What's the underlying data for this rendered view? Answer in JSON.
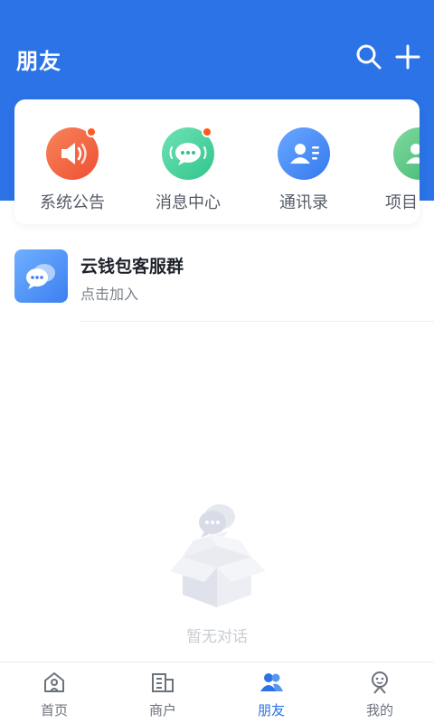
{
  "header": {
    "title": "朋友"
  },
  "quick_entries": [
    {
      "label": "系统公告",
      "icon": "speaker-icon",
      "color": "#f2683f",
      "badge": true
    },
    {
      "label": "消息中心",
      "icon": "message-icon",
      "color": "#3fcc97",
      "badge": true
    },
    {
      "label": "通讯录",
      "icon": "contacts-icon",
      "color": "#3c86f0",
      "badge": false
    },
    {
      "label": "项目",
      "icon": "project-icon",
      "color": "#4bbf7a",
      "badge": false
    }
  ],
  "group": {
    "name": "云钱包客服群",
    "subtitle": "点击加入"
  },
  "empty": {
    "text": "暂无对话"
  },
  "tabbar": {
    "items": [
      {
        "label": "首页",
        "icon": "home-icon",
        "active": false
      },
      {
        "label": "商户",
        "icon": "merchant-icon",
        "active": false
      },
      {
        "label": "朋友",
        "icon": "friends-icon",
        "active": true
      },
      {
        "label": "我的",
        "icon": "profile-icon",
        "active": false
      }
    ]
  },
  "colors": {
    "brand": "#2b73e6",
    "badge": "#ff5a1f"
  }
}
